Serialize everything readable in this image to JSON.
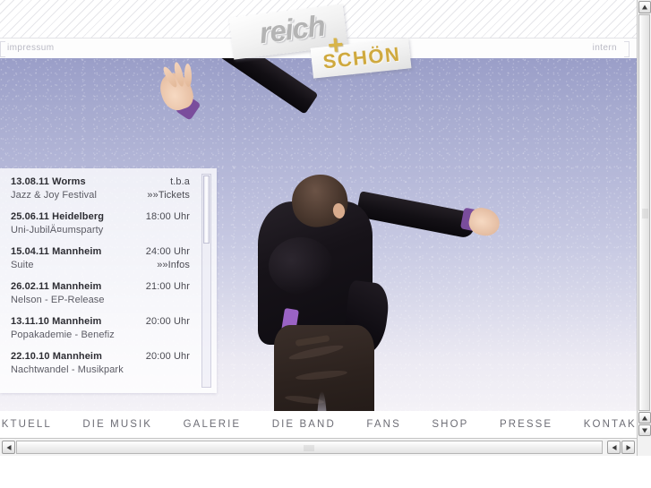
{
  "site": {
    "logo": {
      "word_main": "reich",
      "word_plus": "+",
      "word_second": "SCHÖN"
    },
    "utility": {
      "impressum": "impressum",
      "intern": "intern"
    }
  },
  "tour_dates": {
    "entries": [
      {
        "date_location": "13.08.11 Worms",
        "time": "t.b.a",
        "subtitle": "Jazz & Joy Festival",
        "action": "»»Tickets"
      },
      {
        "date_location": "25.06.11 Heidelberg",
        "time": "18:00 Uhr",
        "subtitle": "Uni-JubilÄ¤umsparty",
        "action": ""
      },
      {
        "date_location": "15.04.11 Mannheim",
        "time": "24:00 Uhr",
        "subtitle": "Suite",
        "action": "»»Infos"
      },
      {
        "date_location": "26.02.11 Mannheim",
        "time": "21:00 Uhr",
        "subtitle": "Nelson - EP-Release",
        "action": ""
      },
      {
        "date_location": "13.11.10 Mannheim",
        "time": "20:00 Uhr",
        "subtitle": "Popakademie - Benefiz",
        "action": ""
      },
      {
        "date_location": "22.10.10 Mannheim",
        "time": "20:00 Uhr",
        "subtitle": "Nachtwandel - Musikpark",
        "action": ""
      }
    ]
  },
  "nav": {
    "items": [
      {
        "label": "AKTUELL"
      },
      {
        "label": "DIE MUSIK"
      },
      {
        "label": "GALERIE"
      },
      {
        "label": "DIE BAND"
      },
      {
        "label": "FANS"
      },
      {
        "label": "SHOP"
      },
      {
        "label": "PRESSE"
      },
      {
        "label": "KONTAKT"
      }
    ]
  },
  "colors": {
    "sky_top": "#9a9ec8",
    "sky_bottom": "#f4f2f7",
    "logo_gold": "#cfa93f",
    "logo_silver": "#b4b4b4",
    "nav_text": "#6d6d75",
    "accent_purple": "#7a4d9c"
  }
}
